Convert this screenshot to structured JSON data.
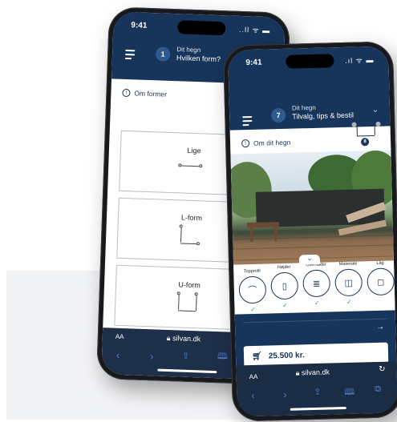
{
  "back_phone": {
    "time": "9:41",
    "status_icons": "..ll ᯤ ▬",
    "step_number": "1",
    "step_line1": "Dit hegn",
    "step_line2": "Hvilken form?",
    "about_label": "Om former",
    "forms": [
      {
        "label": "Lige"
      },
      {
        "label": "L-form"
      },
      {
        "label": "U-form"
      }
    ],
    "text_size": "AA",
    "url": "silvan.dk"
  },
  "front_phone": {
    "time": "9:41",
    "status_icons": ".ıl ᯤ ▬",
    "step_number": "7",
    "step_line1": "Dit hegn",
    "step_line2": "Tilvalg, tips & bestil",
    "fence_badge": "8",
    "about_label": "Om dit hegn",
    "categories": [
      {
        "label": "Topprofil",
        "icon": "⌒"
      },
      {
        "label": "Højder",
        "icon": "▯"
      },
      {
        "label": "Overflader",
        "icon": "≣"
      },
      {
        "label": "Materiale",
        "icon": "◫"
      },
      {
        "label": "Låg",
        "icon": "◻"
      }
    ],
    "price": "25.500 kr.",
    "text_size": "AA",
    "url": "silvan.dk"
  }
}
